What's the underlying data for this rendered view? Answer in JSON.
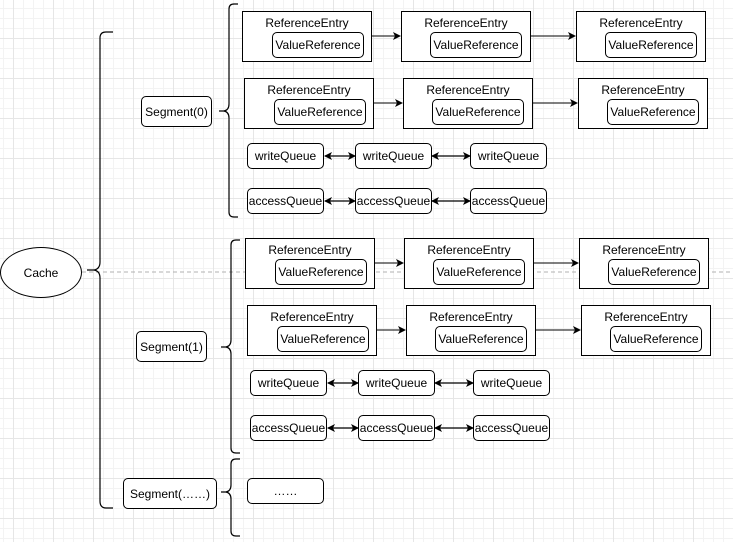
{
  "root": {
    "label": "Cache"
  },
  "segments": [
    {
      "label": "Segment(0)",
      "entry_rows": [
        [
          {
            "entry": "ReferenceEntry",
            "value": "ValueReference"
          },
          {
            "entry": "ReferenceEntry",
            "value": "ValueReference"
          },
          {
            "entry": "ReferenceEntry",
            "value": "ValueReference"
          }
        ],
        [
          {
            "entry": "ReferenceEntry",
            "value": "ValueReference"
          },
          {
            "entry": "ReferenceEntry",
            "value": "ValueReference"
          },
          {
            "entry": "ReferenceEntry",
            "value": "ValueReference"
          }
        ]
      ],
      "write_queue": [
        "writeQueue",
        "writeQueue",
        "writeQueue"
      ],
      "access_queue": [
        "accessQueue",
        "accessQueue",
        "accessQueue"
      ]
    },
    {
      "label": "Segment(1)",
      "entry_rows": [
        [
          {
            "entry": "ReferenceEntry",
            "value": "ValueReference"
          },
          {
            "entry": "ReferenceEntry",
            "value": "ValueReference"
          },
          {
            "entry": "ReferenceEntry",
            "value": "ValueReference"
          }
        ],
        [
          {
            "entry": "ReferenceEntry",
            "value": "ValueReference"
          },
          {
            "entry": "ReferenceEntry",
            "value": "ValueReference"
          },
          {
            "entry": "ReferenceEntry",
            "value": "ValueReference"
          }
        ]
      ],
      "write_queue": [
        "writeQueue",
        "writeQueue",
        "writeQueue"
      ],
      "access_queue": [
        "accessQueue",
        "accessQueue",
        "accessQueue"
      ]
    },
    {
      "label": "Segment(……)",
      "placeholder": "……"
    }
  ]
}
